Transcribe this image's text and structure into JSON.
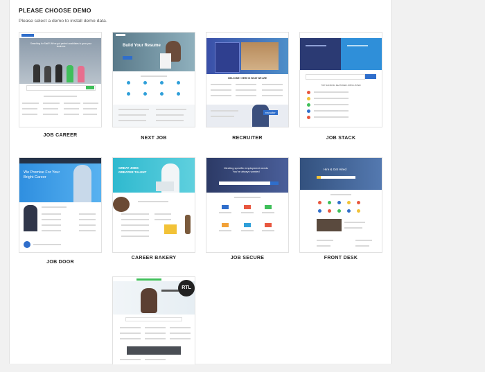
{
  "page": {
    "heading": "PLEASE CHOOSE DEMO",
    "subtitle": "Please select a demo to install demo data."
  },
  "demos": [
    {
      "label": "JOB CAREER",
      "thumb_headline": "Searching for Staff? We've got perfect candidates to grow your business"
    },
    {
      "label": "NEXT JOB",
      "thumb_headline": "Build Your Resume"
    },
    {
      "label": "RECRUITER",
      "thumb_headline": "WELCOME ! HERE IS WHAT WE ARE",
      "thumb_badge": "recruiter"
    },
    {
      "label": "JOB STACK",
      "thumb_headline": "TOP RANKING FEATURED JOBS LISTED"
    },
    {
      "label": "JOB DOOR",
      "thumb_headline": "We Promise For Your Bright Career"
    },
    {
      "label": "CAREER BAKERY",
      "thumb_headline": "GREAT JOBS GREATER TALENT"
    },
    {
      "label": "JOB SECURE",
      "thumb_headline": "Meeting specific employment needs You've always wanted"
    },
    {
      "label": "FRONT DESK",
      "thumb_headline": "Hire & Get Hired"
    },
    {
      "label": "",
      "thumb_badge": "RTL"
    }
  ],
  "colors": {
    "accent_blue": "#2f6ecb",
    "accent_green": "#3fbf5a",
    "accent_yellow": "#f2c237"
  }
}
